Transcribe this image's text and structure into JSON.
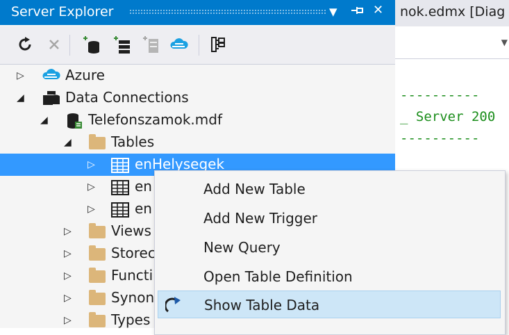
{
  "panel": {
    "title": "Server Explorer",
    "buttons": {
      "dropdown": "▼",
      "pin": "⊣",
      "close": "✕"
    }
  },
  "toolbar": {
    "items": [
      "refresh-icon",
      "stop-icon",
      "connect-database-icon",
      "add-connection-icon",
      "add-sql-server-icon",
      "connect-azure-icon",
      "properties-icon"
    ]
  },
  "tree": {
    "nodes": [
      {
        "label": "Azure",
        "icon": "azure-cloud-icon",
        "level": 0,
        "expanded": false
      },
      {
        "label": "Data Connections",
        "icon": "data-connections-icon",
        "level": 0,
        "expanded": true
      },
      {
        "label": "Telefonszamok.mdf",
        "icon": "database-file-icon",
        "level": 1,
        "expanded": true
      },
      {
        "label": "Tables",
        "icon": "folder-icon",
        "level": 2,
        "expanded": true
      },
      {
        "label": "enHelysegek",
        "icon": "table-icon",
        "level": 3,
        "expanded": false,
        "selected": true
      },
      {
        "label": "en",
        "icon": "table-icon",
        "level": 3,
        "expanded": false
      },
      {
        "label": "en",
        "icon": "table-icon",
        "level": 3,
        "expanded": false
      },
      {
        "label": "Views",
        "icon": "folder-icon",
        "level": 2,
        "expanded": false
      },
      {
        "label": "Storec",
        "icon": "folder-icon",
        "level": 2,
        "expanded": false
      },
      {
        "label": "Functi",
        "icon": "folder-icon",
        "level": 2,
        "expanded": false
      },
      {
        "label": "Synon",
        "icon": "folder-icon",
        "level": 2,
        "expanded": false
      },
      {
        "label": "Types",
        "icon": "folder-icon",
        "level": 2,
        "expanded": false
      }
    ]
  },
  "editor": {
    "tab_label": "nok.edmx [Diag",
    "code_lines": [
      "----------",
      "_ Server 200",
      "----------"
    ],
    "code_color": "#1a8d1a"
  },
  "context_menu": {
    "items": [
      {
        "label": "Add New Table",
        "icon": ""
      },
      {
        "label": "Add New Trigger",
        "icon": ""
      },
      {
        "label": "New Query",
        "icon": ""
      },
      {
        "label": "Open Table Definition",
        "icon": ""
      },
      {
        "label": "Show Table Data",
        "icon": "show-data-arrow-icon",
        "hover": true
      }
    ]
  },
  "colors": {
    "accent": "#007acc",
    "selection": "#3399ff",
    "menu_hover": "#cde6f7"
  }
}
